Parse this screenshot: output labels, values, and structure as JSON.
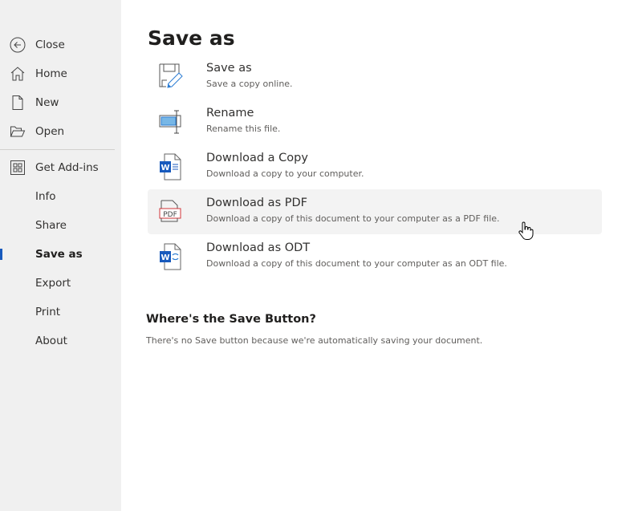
{
  "sidebar": {
    "items": [
      {
        "label": "Close",
        "icon": "back-arrow-icon"
      },
      {
        "label": "Home",
        "icon": "home-icon"
      },
      {
        "label": "New",
        "icon": "new-document-icon"
      },
      {
        "label": "Open",
        "icon": "folder-open-icon"
      },
      {
        "label": "Get Add-ins",
        "icon": "add-ins-grid-icon"
      },
      {
        "label": "Info"
      },
      {
        "label": "Share"
      },
      {
        "label": "Save as",
        "active": true
      },
      {
        "label": "Export"
      },
      {
        "label": "Print"
      },
      {
        "label": "About"
      }
    ]
  },
  "main": {
    "title": "Save as",
    "options": [
      {
        "title": "Save as",
        "description": "Save a copy online.",
        "icon": "save-as-pencil-icon"
      },
      {
        "title": "Rename",
        "description": "Rename this file.",
        "icon": "rename-icon"
      },
      {
        "title": "Download a Copy",
        "description": "Download a copy to your computer.",
        "icon": "word-document-icon"
      },
      {
        "title": "Download as PDF",
        "description": "Download a copy of this document to your computer as a PDF file.",
        "icon": "pdf-icon",
        "icon_text": "PDF",
        "hovered": true
      },
      {
        "title": "Download as ODT",
        "description": "Download a copy of this document to your computer as an ODT file.",
        "icon": "word-odt-icon"
      }
    ],
    "save_info": {
      "heading": "Where's the Save Button?",
      "text": "There's no Save button because we're automatically saving your document."
    }
  },
  "colors": {
    "accent": "#185abd",
    "word_blue": "#185abd",
    "pdf_red": "#d13438",
    "sidebar_bg": "#f0f0f0",
    "hover_bg": "#f3f3f3"
  }
}
